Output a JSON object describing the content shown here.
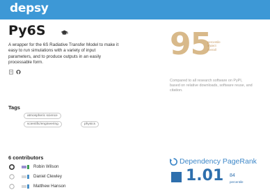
{
  "header": {
    "brand": "depsy",
    "color": "#3d98d6"
  },
  "package": {
    "title": "Py6S",
    "description": "A wrapper for the 6S Radiative Transfer Model to make it easy to run simulations with a variety of input parameters, and to produce outputs in an easily processable form."
  },
  "impact": {
    "score": "95",
    "label": "percentile impact overall",
    "description": "Compared to all research software on PyPI, based on relative downloads, software reuse, and citation."
  },
  "tags": {
    "title": "Tags",
    "items": [
      "atmospheric science",
      "scientific/engineering",
      "physics"
    ]
  },
  "contributors": {
    "title": "6 contributors",
    "items": [
      {
        "name": "Robin Wilson"
      },
      {
        "name": "Daniel Clewley"
      },
      {
        "name": "Matthew Hanson"
      }
    ]
  },
  "dependency": {
    "title": "Dependency PageRank",
    "value": "1.01",
    "percentile": "84",
    "percentile_label": "percentile"
  }
}
